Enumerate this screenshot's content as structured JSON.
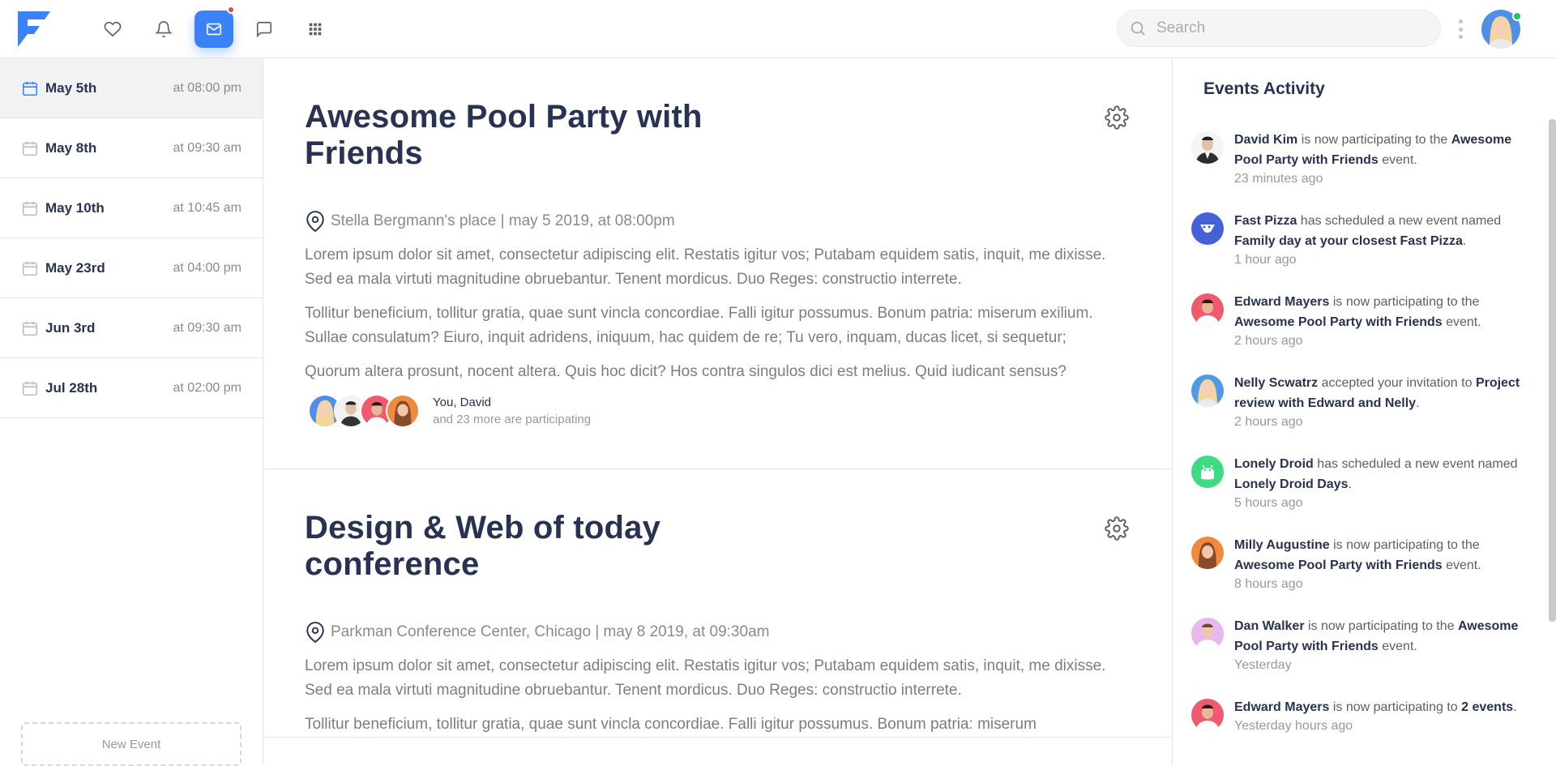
{
  "nav": {
    "search_placeholder": "Search",
    "accent": "#3b82f6"
  },
  "sidebar": {
    "items": [
      {
        "date": "May 5th",
        "time": "at 08:00 pm"
      },
      {
        "date": "May 8th",
        "time": "at 09:30 am"
      },
      {
        "date": "May 10th",
        "time": "at 10:45 am"
      },
      {
        "date": "May 23rd",
        "time": "at 04:00 pm"
      },
      {
        "date": "Jun 3rd",
        "time": "at 09:30 am"
      },
      {
        "date": "Jul 28th",
        "time": "at 02:00 pm"
      }
    ],
    "new_event_label": "New Event"
  },
  "events": [
    {
      "title": "Awesome Pool Party with Friends",
      "location": "Stella Bergmann's place | may 5 2019, at 08:00pm",
      "paragraphs": [
        "Lorem ipsum dolor sit amet, consectetur adipiscing elit. Restatis igitur vos; Putabam equidem satis, inquit, me dixisse. Sed ea mala virtuti magnitudine obruebantur. Tenent mordicus. Duo Reges: constructio interrete.",
        "Tollitur beneficium, tollitur gratia, quae sunt vincla concordiae. Falli igitur possumus. Bonum patria: miserum exilium. Sullae consulatum? Eiuro, inquit adridens, iniquum, hac quidem de re; Tu vero, inquam, ducas licet, si sequetur;",
        "Quorum altera prosunt, nocent altera. Quis hoc dicit? Hos contra singulos dici est melius. Quid iudicant sensus?"
      ],
      "participants_line1": "You, David",
      "participants_line2": "and 23 more are participating"
    },
    {
      "title": "Design & Web of today conference",
      "location": "Parkman Conference Center, Chicago | may 8 2019, at 09:30am",
      "paragraphs": [
        "Lorem ipsum dolor sit amet, consectetur adipiscing elit. Restatis igitur vos; Putabam equidem satis, inquit, me dixisse. Sed ea mala virtuti magnitudine obruebantur. Tenent mordicus. Duo Reges: constructio interrete.",
        "Tollitur beneficium, tollitur gratia, quae sunt vincla concordiae. Falli igitur possumus. Bonum patria: miserum"
      ]
    }
  ],
  "activity": {
    "title": "Events Activity",
    "items": [
      {
        "actor": "David Kim",
        "text1": " is now participating to the ",
        "target": "Awesome Pool Party with Friends",
        "text2": " event.",
        "time": "23 minutes ago",
        "avatar": "person-dark"
      },
      {
        "actor": "Fast Pizza",
        "text1": " has scheduled a new event named ",
        "target": "Family day at your closest Fast Pizza",
        "text2": ".",
        "time": "1 hour ago",
        "avatar": "fast-pizza-logo"
      },
      {
        "actor": "Edward Mayers",
        "text1": " is now participating to the ",
        "target": "Awesome Pool Party with Friends",
        "text2": " event.",
        "time": "2 hours ago",
        "avatar": "person-red"
      },
      {
        "actor": "Nelly Scwatrz",
        "text1": " accepted your invitation to ",
        "target": "Project review with Edward and Nelly",
        "text2": ".",
        "time": "2 hours ago",
        "avatar": "person-blue"
      },
      {
        "actor": "Lonely Droid",
        "text1": " has scheduled a new event named ",
        "target": "Lonely Droid Days",
        "text2": ".",
        "time": "5 hours ago",
        "avatar": "droid-logo"
      },
      {
        "actor": "Milly Augustine",
        "text1": " is now participating to the ",
        "target": "Awesome Pool Party with Friends",
        "text2": " event.",
        "time": "8 hours ago",
        "avatar": "person-orange"
      },
      {
        "actor": "Dan Walker",
        "text1": " is now participating to the ",
        "target": "Awesome Pool Party with Friends",
        "text2": " event.",
        "time": "Yesterday",
        "avatar": "person-pink"
      },
      {
        "actor": "Edward Mayers",
        "text1": " is now participating to ",
        "target": "2 events",
        "text2": ".",
        "time": "Yesterday hours ago",
        "avatar": "person-red"
      }
    ]
  }
}
